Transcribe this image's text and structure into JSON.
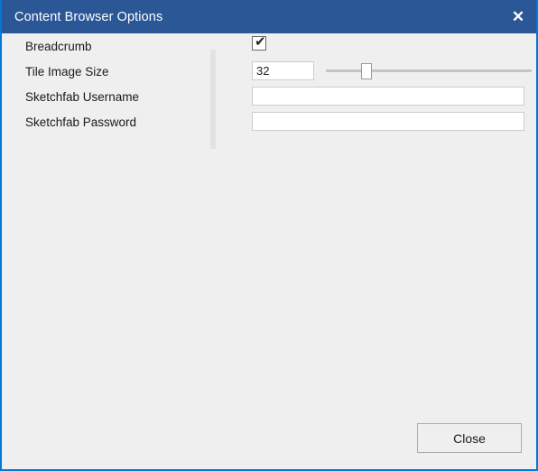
{
  "window": {
    "title": "Content Browser Options",
    "titlebar_color": "#2b5797",
    "border_color": "#0078D7",
    "background_color": "#efefef",
    "close_icon": "close-icon",
    "close_glyph": "✕"
  },
  "form": {
    "rows": [
      {
        "label": "Breadcrumb",
        "control": "checkbox",
        "checked": true,
        "check_glyph": "✔"
      },
      {
        "label": "Tile Image Size",
        "control": "number-with-slider",
        "value": "32",
        "placeholder": "",
        "slider_position_percent": 18
      },
      {
        "label": "Sketchfab Username",
        "control": "text",
        "value": "",
        "placeholder": ""
      },
      {
        "label": "Sketchfab Password",
        "control": "password",
        "value": "",
        "placeholder": ""
      }
    ]
  },
  "footer": {
    "close_label": "Close"
  }
}
